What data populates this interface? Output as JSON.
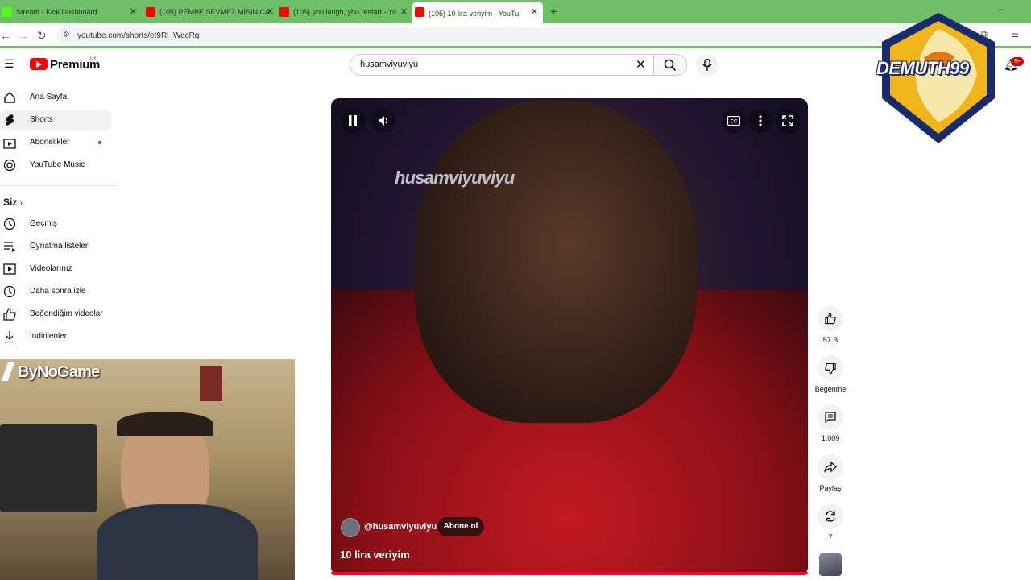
{
  "browser": {
    "tabs": [
      {
        "title": "Stream - Kick Dashboard",
        "favicon_color": "#53fc18"
      },
      {
        "title": "(105) PEMBE SEVMEZ MİSİN CA",
        "favicon_color": "#ff0000"
      },
      {
        "title": "(105) you laugh, you restart - Yo",
        "favicon_color": "#ff0000"
      },
      {
        "title": "(105) 10 lira veriyim - YouTu",
        "favicon_color": "#ff0000"
      }
    ],
    "url": "youtube.com/shorts/et9Rl_WacRg"
  },
  "header": {
    "brand": "Premium",
    "region": "TR",
    "search_value": "husamviyuviyu",
    "notifications": "9+"
  },
  "sidebar": {
    "items": [
      {
        "label": "Ana Sayfa",
        "icon": "home-icon"
      },
      {
        "label": "Shorts",
        "icon": "shorts-icon"
      },
      {
        "label": "Abonelikler",
        "icon": "subscriptions-icon"
      },
      {
        "label": "YouTube Music",
        "icon": "music-icon"
      }
    ],
    "you_section": "Siz",
    "you_items": [
      {
        "label": "Geçmiş",
        "icon": "history-icon"
      },
      {
        "label": "Oynatma listeleri",
        "icon": "playlist-icon"
      },
      {
        "label": "Videolarınız",
        "icon": "your-videos-icon"
      },
      {
        "label": "Daha sonra izle",
        "icon": "watch-later-icon"
      },
      {
        "label": "Beğendiğim videolar",
        "icon": "liked-icon"
      },
      {
        "label": "İndirilenler",
        "icon": "downloads-icon"
      }
    ]
  },
  "webcam": {
    "label": "ByNoGame"
  },
  "video": {
    "watermark": "husamviyuviyu",
    "channel": "@husamviyuviyu",
    "subscribe_label": "Abone ol",
    "title": "10 lira veriyim"
  },
  "actions": {
    "likes": "57 B",
    "dislike_label": "Beğenme",
    "comments": "1.009",
    "share_label": "Paylaş",
    "remix_count": "7"
  },
  "overlay": {
    "text": "DEMUTH99"
  },
  "colors": {
    "accent": "#ff0000",
    "tab_bar": "#6fbe68"
  }
}
